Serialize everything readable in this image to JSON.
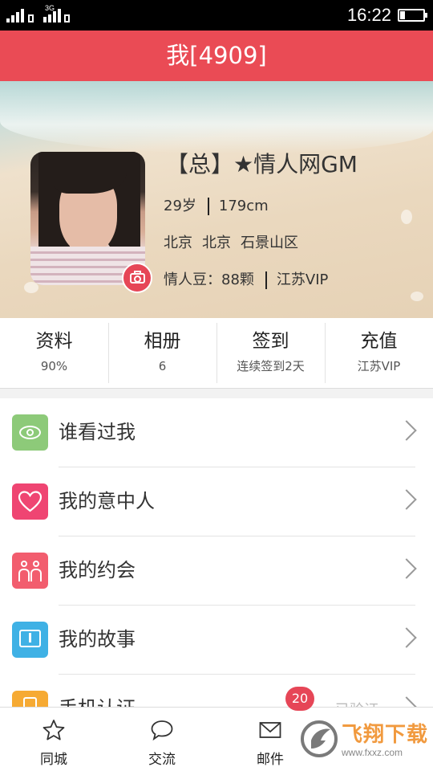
{
  "status_bar": {
    "network_1": "",
    "network_2": "3G",
    "time": "16:22",
    "battery_level": 0.22
  },
  "title_bar": {
    "title": "我[4909]"
  },
  "profile": {
    "name": "【总】★情人网GM",
    "age": "29岁",
    "height": "179cm",
    "province": "北京",
    "city": "北京",
    "district": "石景山区",
    "beans": "情人豆：88颗",
    "vip": "江苏VIP"
  },
  "stats": [
    {
      "label": "资料",
      "value": "90%"
    },
    {
      "label": "相册",
      "value": "6"
    },
    {
      "label": "签到",
      "value": "连续签到2天"
    },
    {
      "label": "充值",
      "value": "江苏VIP"
    }
  ],
  "menu": [
    {
      "label": "谁看过我",
      "icon": "eye-icon",
      "color": "#8dca79"
    },
    {
      "label": "我的意中人",
      "icon": "heart-icon",
      "color": "#ef4572"
    },
    {
      "label": "我的约会",
      "icon": "couple-icon",
      "color": "#f25d6e"
    },
    {
      "label": "我的故事",
      "icon": "story-icon",
      "color": "#3fb1e5"
    },
    {
      "label": "手机认证",
      "icon": "phone-icon",
      "color": "#f6aa33",
      "right_text": "已验证"
    }
  ],
  "bottom_nav": [
    {
      "label": "同城",
      "icon": "star-icon"
    },
    {
      "label": "交流",
      "icon": "chat-bubble-icon"
    },
    {
      "label": "邮件",
      "icon": "mail-icon",
      "badge": "20"
    }
  ],
  "watermark": {
    "title": "飞翔下载",
    "url": "www.fxxz.com"
  },
  "colors": {
    "accent": "#ea4b55",
    "badge": "#e64657"
  }
}
